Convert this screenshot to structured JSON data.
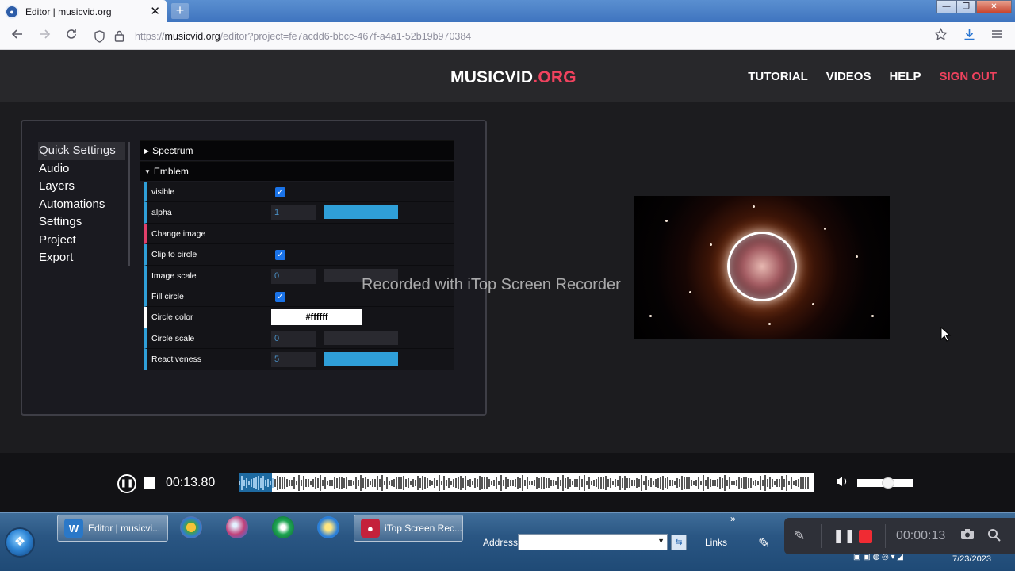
{
  "browser": {
    "tab_title": "Editor | musicvid.org",
    "tab_close": "✕",
    "new_tab": "+",
    "url_prefix": "https://",
    "url_host": "musicvid.org",
    "url_path": "/editor?project=fe7acdd6-bbcc-467f-a4a1-52b19b970384",
    "window_controls": [
      "—",
      "❐",
      "✕"
    ]
  },
  "site": {
    "logo_main": "MUSICVID",
    "logo_suffix": ".ORG",
    "nav": [
      "TUTORIAL",
      "VIDEOS",
      "HELP",
      "SIGN OUT"
    ],
    "accent_color": "#f0425e"
  },
  "side_menu": [
    "Quick Settings",
    "Audio",
    "Layers",
    "Automations",
    "Settings",
    "Project",
    "Export"
  ],
  "sections": {
    "spectrum": "Spectrum",
    "emblem": "Emblem"
  },
  "settings": [
    {
      "label": "visible",
      "type": "checkbox",
      "checked": true
    },
    {
      "label": "alpha",
      "type": "number",
      "value": "1",
      "slider_fraction": 1.0
    },
    {
      "label": "Change image",
      "type": "action"
    },
    {
      "label": "Clip to circle",
      "type": "checkbox",
      "checked": true
    },
    {
      "label": "Image scale",
      "type": "number",
      "value": "0",
      "slider_fraction": 0.0
    },
    {
      "label": "Fill circle",
      "type": "checkbox",
      "checked": true
    },
    {
      "label": "Circle color",
      "type": "color",
      "value": "#ffffff"
    },
    {
      "label": "Circle scale",
      "type": "number",
      "value": "0",
      "slider_fraction": 0.0
    },
    {
      "label": "Reactiveness",
      "type": "number",
      "value": "5",
      "slider_fraction": 1.0
    }
  ],
  "watermark": "Recorded with iTop Screen Recorder",
  "player": {
    "time": "00:13.80",
    "progress_fraction": 0.058,
    "volume_fraction": 0.55
  },
  "taskbar": {
    "tasks": [
      "Editor | musicvi...",
      "iTop Screen Rec..."
    ],
    "address_label": "Address",
    "address_value": "",
    "links_label": "Links",
    "chevron": "»",
    "date": "7/23/2023"
  },
  "recorder": {
    "time": "00:00:13"
  }
}
